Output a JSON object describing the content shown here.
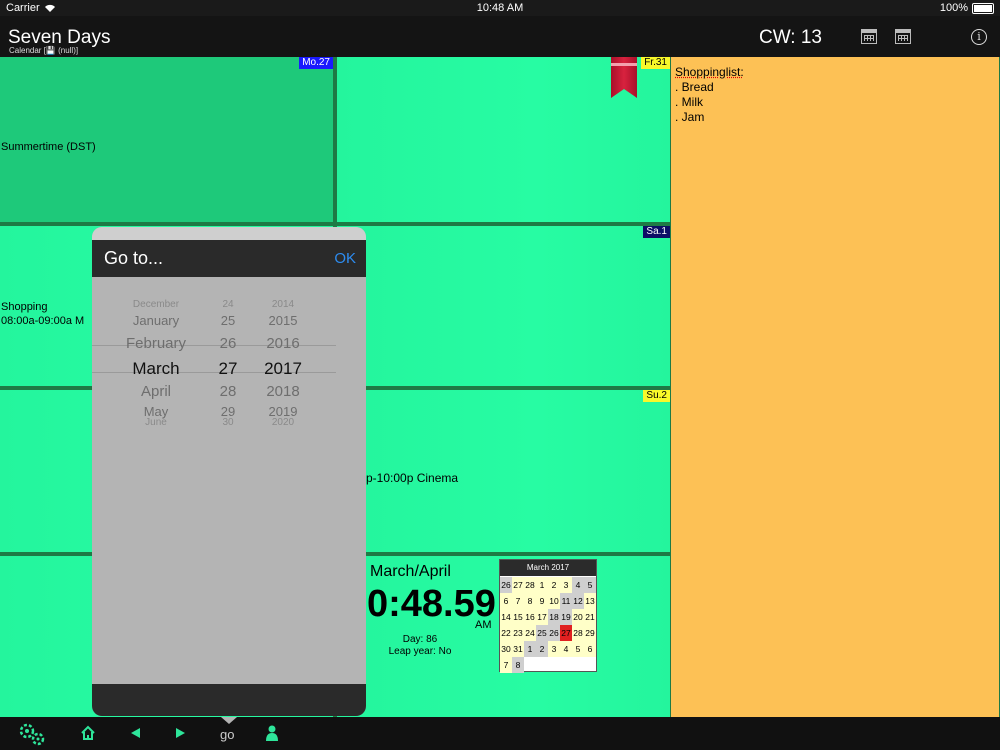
{
  "status_bar": {
    "carrier": "Carrier",
    "time": "10:48 AM",
    "battery": "100%"
  },
  "nav": {
    "title": "Seven Days",
    "subtitle": "Calendar [💾 (null)]",
    "cw": "CW: 13",
    "icons": [
      "calendar-icon",
      "calendar-icon",
      "info-icon"
    ]
  },
  "days": {
    "mo": {
      "label": "Mo.27",
      "event": "Summertime (DST)"
    },
    "fr": {
      "label": "Fr.31"
    },
    "sa": {
      "label": "Sa.1"
    },
    "su": {
      "label": "Su.2"
    },
    "tu_event": {
      "title": "Shopping",
      "time": "08:00a-09:00a  M"
    },
    "th_event": "p-10:00p  Cinema"
  },
  "notes": {
    "heading": "Shoppinglist:",
    "items": [
      ". Bread",
      ". Milk",
      ". Jam"
    ]
  },
  "clock": {
    "month": "March/April",
    "time": "0:48.59",
    "ampm": "AM",
    "day": "Day: 86",
    "leap": "Leap year: No"
  },
  "minical": {
    "title": "March 2017",
    "rows": [
      [
        "26",
        "27",
        "28",
        "1",
        "2",
        "3",
        "4"
      ],
      [
        "5",
        "6",
        "7",
        "8",
        "9",
        "10",
        "11"
      ],
      [
        "12",
        "13",
        "14",
        "15",
        "16",
        "17",
        "18"
      ],
      [
        "19",
        "20",
        "21",
        "22",
        "23",
        "24",
        "25"
      ],
      [
        "26",
        "27",
        "28",
        "29",
        "30",
        "31",
        "1"
      ],
      [
        "2",
        "3",
        "4",
        "5",
        "6",
        "7",
        "8"
      ]
    ]
  },
  "goto": {
    "title": "Go to...",
    "ok": "OK",
    "months": [
      "December",
      "January",
      "February",
      "March",
      "April",
      "May",
      "June"
    ],
    "days": [
      "24",
      "25",
      "26",
      "27",
      "28",
      "29",
      "30"
    ],
    "years": [
      "2014",
      "2015",
      "2016",
      "2017",
      "2018",
      "2019",
      "2020"
    ]
  },
  "tabbar": {
    "go": "go",
    "icons": [
      "settings-gears-icon",
      "home-icon",
      "arrow-left-icon",
      "arrow-right-icon",
      "person-icon"
    ]
  },
  "colors": {
    "cell": "#27fca3",
    "today": "#1ec97a",
    "notes": "#fdc155",
    "accent": "#2d8cf0",
    "tab": "#2ee59a"
  }
}
